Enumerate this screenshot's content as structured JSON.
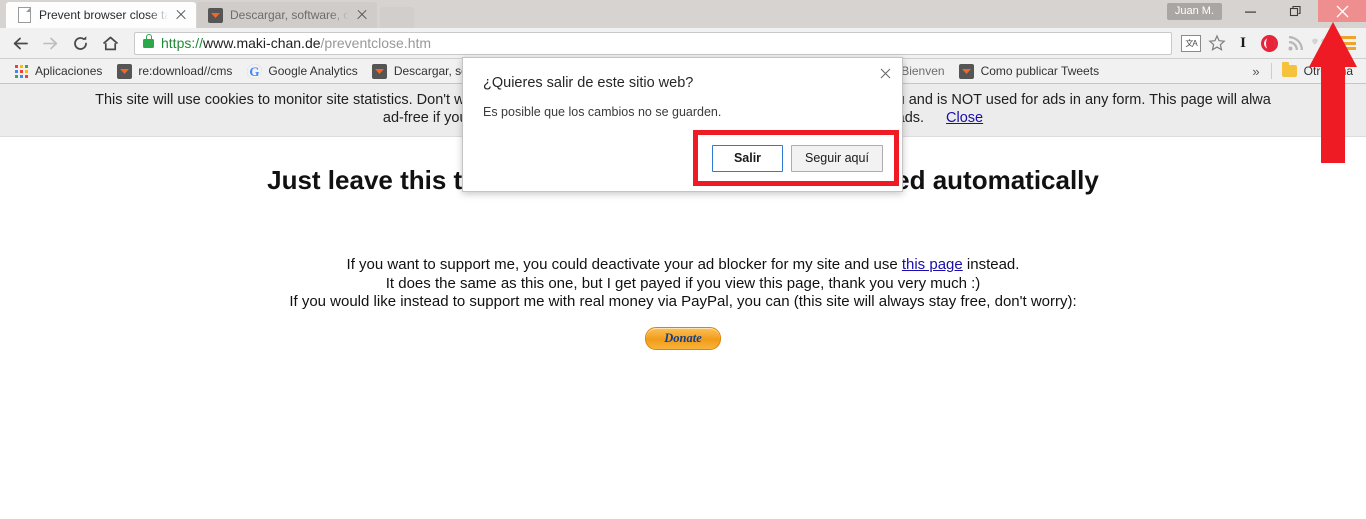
{
  "window": {
    "user_chip": "Juan M.",
    "minimize_icon": "minimize-icon",
    "maximize_icon": "restore-icon",
    "close_icon": "close-icon",
    "close_button_color": "#ef8e8e"
  },
  "tabs": [
    {
      "title": "Prevent browser close tab",
      "icon": "page-icon",
      "active": true
    },
    {
      "title": "Descargar, software, cont",
      "icon": "download-icon",
      "active": false
    }
  ],
  "toolbar": {
    "back_icon": "back-arrow-icon",
    "forward_icon": "forward-arrow-icon",
    "reload_icon": "reload-icon",
    "home_icon": "home-icon",
    "url": {
      "scheme": "https://",
      "host": "www.maki-chan.de",
      "path": "/preventclose.htm",
      "lock_icon": "lock-icon",
      "lock_color": "#2aa84a"
    },
    "translate_icon": "translate-icon",
    "bookmark_star_icon": "star-icon",
    "extensions": [
      {
        "name": "ext-i-icon",
        "label": "I"
      },
      {
        "name": "opera-blocker-icon",
        "label": ""
      },
      {
        "name": "rss-icon",
        "label": ""
      },
      {
        "name": "twitter-birds-icon",
        "label": ""
      }
    ],
    "menu_icon": "hamburger-menu-icon",
    "menu_color": "#f0a32a"
  },
  "bookmarks": {
    "items": [
      {
        "label": "Aplicaciones",
        "icon": "apps-grid-icon"
      },
      {
        "label": "re:download//cms",
        "icon": "download-icon"
      },
      {
        "label": "Google Analytics",
        "icon": "google-icon"
      },
      {
        "label": "Descargar, softw",
        "icon": "download-icon"
      },
      {
        "label": "Bienven",
        "icon": "none"
      },
      {
        "label": "Como publicar Tweets",
        "icon": "download-icon"
      }
    ],
    "overflow_label": "»",
    "other_bookmarks": {
      "label": "Otros ma",
      "icon": "folder-icon"
    }
  },
  "page": {
    "cookie_banner": {
      "line1": "This site will use cookies to monitor site statistics. Don't worry, th",
      "line1_right": "u and is NOT used for ads in any form. This page will alwa",
      "line2": "ad-free if you",
      "line2_right": "h ads.",
      "close_link": "Close"
    },
    "headline_left": "Just leave this ta",
    "headline_right": "sed automatically",
    "paragraph": {
      "line1_a": "If you want to support me, you could deactivate your ad blocker for my site and use ",
      "line1_link": "this page",
      "line1_b": " instead.",
      "line2": "It does the same as this one, but I get payed if you view this page, thank you very much :)",
      "line3": "If you would like instead to support me with real money via PayPal, you can (this site will always stay free, don't worry):"
    },
    "donate_label": "Donate"
  },
  "dialog": {
    "title": "¿Quieres salir de este sitio web?",
    "message": "Es posible que los cambios no se guarden.",
    "close_icon": "dialog-close-icon",
    "leave_button": "Salir",
    "stay_button": "Seguir aquí",
    "highlight_color": "#ee1b24"
  },
  "annotation": {
    "arrow_color": "#ee1b24",
    "arrow_name": "red-arrow-pointing-to-close-button"
  }
}
